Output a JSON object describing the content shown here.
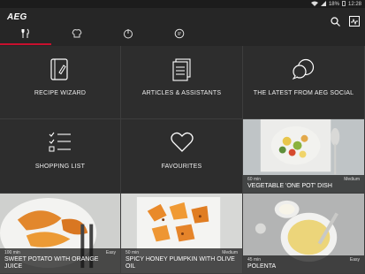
{
  "status": {
    "battery": "18%",
    "time": "12:28"
  },
  "brand": {
    "logo_text": "AEG",
    "accent": "#c8102e"
  },
  "tabs": [
    {
      "name": "recipes",
      "icon": "fork-knife-icon",
      "active": true
    },
    {
      "name": "chef",
      "icon": "chef-hat-icon",
      "active": false
    },
    {
      "name": "power",
      "icon": "power-icon",
      "active": false
    },
    {
      "name": "chat",
      "icon": "chat-bubble-icon",
      "active": false
    }
  ],
  "tiles": {
    "recipe_wizard": "RECIPE WIZARD",
    "articles": "ARTICLES & ASSISTANTS",
    "social": "THE LATEST FROM AEG SOCIAL",
    "shopping": "SHOPPING LIST",
    "favourites": "FAVOURITES"
  },
  "recipes": [
    {
      "time": "60 min",
      "level": "Medium",
      "title": "VEGETABLE 'ONE POT' DISH"
    },
    {
      "time": "100 min",
      "level": "Easy",
      "title": "SWEET POTATO WITH ORANGE JUICE"
    },
    {
      "time": "50 min",
      "level": "Medium",
      "title": "SPICY HONEY PUMPKIN WITH OLIVE OIL"
    },
    {
      "time": "45 min",
      "level": "Easy",
      "title": "POLENTA"
    }
  ]
}
